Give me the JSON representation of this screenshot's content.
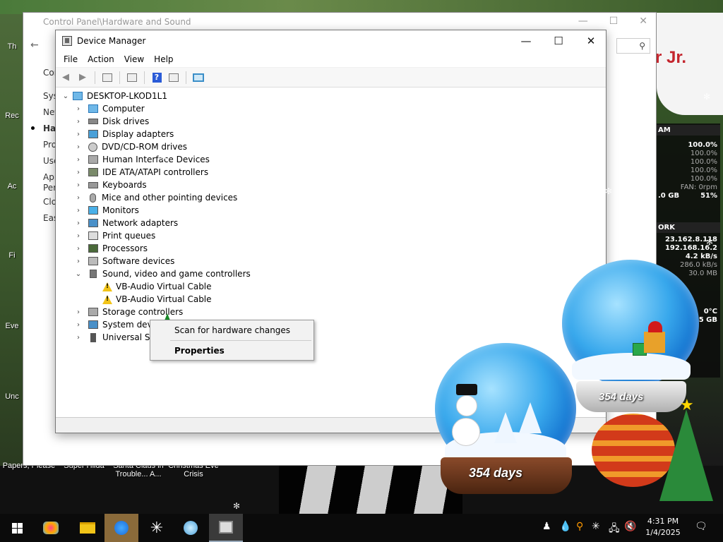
{
  "control_panel": {
    "title": "Control Panel\\Hardware and Sound",
    "sidebar": [
      "Con",
      "Syst",
      "Net",
      "Har",
      "Pro",
      "Use",
      "App",
      "Per",
      "Clo",
      "Eas"
    ],
    "search_placeholder": "r Jr."
  },
  "device_manager": {
    "title": "Device Manager",
    "menu": [
      "File",
      "Action",
      "View",
      "Help"
    ],
    "root": "DESKTOP-LKOD1L1",
    "categories": [
      {
        "label": "Computer",
        "icon": "computer-icon"
      },
      {
        "label": "Disk drives",
        "icon": "disk-icon"
      },
      {
        "label": "Display adapters",
        "icon": "display-adapter-icon"
      },
      {
        "label": "DVD/CD-ROM drives",
        "icon": "dvd-icon"
      },
      {
        "label": "Human Interface Devices",
        "icon": "hid-icon"
      },
      {
        "label": "IDE ATA/ATAPI controllers",
        "icon": "ide-icon"
      },
      {
        "label": "Keyboards",
        "icon": "keyboard-icon"
      },
      {
        "label": "Mice and other pointing devices",
        "icon": "mouse-icon"
      },
      {
        "label": "Monitors",
        "icon": "monitor-icon"
      },
      {
        "label": "Network adapters",
        "icon": "network-icon"
      },
      {
        "label": "Print queues",
        "icon": "printer-icon"
      },
      {
        "label": "Processors",
        "icon": "processor-icon"
      },
      {
        "label": "Software devices",
        "icon": "software-icon"
      },
      {
        "label": "Sound, video and game controllers",
        "icon": "sound-icon",
        "expanded": true,
        "children": [
          "VB-Audio Virtual Cable",
          "VB-Audio Virtual Cable"
        ]
      },
      {
        "label": "Storage controllers",
        "icon": "storage-icon"
      },
      {
        "label": "System devices",
        "icon": "system-icon"
      },
      {
        "label": "Universal Serial Bus controllers",
        "icon": "usb-icon"
      }
    ]
  },
  "context_menu": {
    "items": [
      "Scan for hardware changes",
      "Properties"
    ]
  },
  "gadget": {
    "ram_header": "AM",
    "ram_total": "100.0%",
    "ram_rows": [
      "100.0%",
      "100.0%",
      "100.0%",
      "100.0%"
    ],
    "fan": "FAN: 0rpm",
    "mem_left": ".0 GB",
    "mem_right": "51%",
    "net_header": "ORK",
    "ip1": "23.162.8.118",
    "ip2": "192.168.16.2",
    "down": "4.2 kB/s",
    "up": "286.0 kB/s",
    "mb": "30.0 MB",
    "temp": "0°C",
    "disk": "9.5 GB"
  },
  "desktop_labels": {
    "papers": "Papers, Please",
    "super": "Super Hilda",
    "santa": "Santa Claus in Trouble... A...",
    "christmas": "Christmas Eve Crisis",
    "left_icons": [
      "Th",
      "Rec",
      "Ac",
      "Fi",
      "Eve",
      "Unc"
    ]
  },
  "snowglobes": {
    "days_big": "354 days",
    "days_small": "354 days"
  },
  "taskbar": {
    "time": "4:31 PM",
    "date": "1/4/2025"
  },
  "colors": {
    "accent": "#0078d7",
    "warning": "#f2c418",
    "banner_red": "#c4252d"
  }
}
